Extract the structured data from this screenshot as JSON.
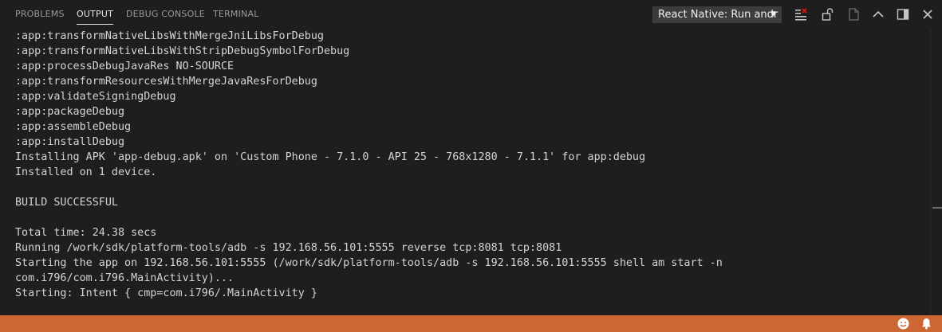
{
  "tabs": {
    "problems": "PROBLEMS",
    "output": "OUTPUT",
    "debug_console": "DEBUG CONSOLE",
    "terminal": "TERMINAL"
  },
  "channel": {
    "selected": "React Native: Run andr",
    "caret": "▼"
  },
  "actions": {
    "clear": "clear-output-icon",
    "lock": "lock-scroll-icon",
    "open_log": "open-log-file-icon",
    "maximize": "chevron-up-icon",
    "split": "toggle-panel-icon",
    "close": "close-icon"
  },
  "output": {
    "lines": [
      ":app:transformNativeLibsWithMergeJniLibsForDebug",
      ":app:transformNativeLibsWithStripDebugSymbolForDebug",
      ":app:processDebugJavaRes NO-SOURCE",
      ":app:transformResourcesWithMergeJavaResForDebug",
      ":app:validateSigningDebug",
      ":app:packageDebug",
      ":app:assembleDebug",
      ":app:installDebug",
      "Installing APK 'app-debug.apk' on 'Custom Phone - 7.1.0 - API 25 - 768x1280 - 7.1.1' for app:debug",
      "Installed on 1 device.",
      "",
      "BUILD SUCCESSFUL",
      "",
      "Total time: 24.38 secs",
      "Running /work/sdk/platform-tools/adb -s 192.168.56.101:5555 reverse tcp:8081 tcp:8081",
      "Starting the app on 192.168.56.101:5555 (/work/sdk/platform-tools/adb -s 192.168.56.101:5555 shell am start -n",
      "com.i796/com.i796.MainActivity)...",
      "Starting: Intent { cmp=com.i796/.MainActivity }"
    ]
  },
  "statusbar": {
    "background": "#cc6633",
    "icons": [
      "smiley-feedback-icon",
      "bell-icon"
    ]
  },
  "colors": {
    "panel_bg": "#1e1e1e",
    "text": "#d4d4d4",
    "tab_inactive": "#9a9a9a",
    "tab_active": "#e7e7e7",
    "statusbar": "#cc6633"
  }
}
